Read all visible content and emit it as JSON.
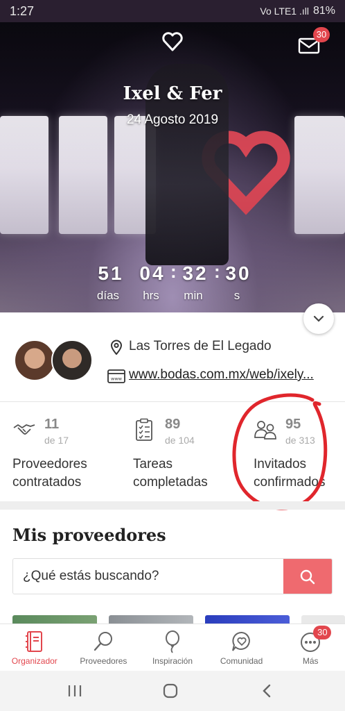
{
  "status_bar": {
    "time": "1:27",
    "signal": "Vo LTE1 .ıll",
    "battery": "81%"
  },
  "hero": {
    "couple_name": "Ixel & Fer",
    "date": "24 Agosto 2019",
    "mail_badge": "30",
    "countdown": {
      "days": "51",
      "hours": "04",
      "minutes": "32",
      "seconds": "30",
      "days_label": "días",
      "hours_label": "hrs",
      "minutes_label": "min",
      "seconds_label": "s"
    }
  },
  "info": {
    "venue": "Las Torres de El Legado",
    "website": "www.bodas.com.mx/web/ixely..."
  },
  "stats": [
    {
      "value": "11",
      "total": "de 17",
      "label_line1": "Proveedores",
      "label_line2": "contratados",
      "icon": "handshake-icon"
    },
    {
      "value": "89",
      "total": "de 104",
      "label_line1": "Tareas",
      "label_line2": "completadas",
      "icon": "checklist-icon"
    },
    {
      "value": "95",
      "total": "de 313",
      "label_line1": "Invitados",
      "label_line2": "confirmados",
      "icon": "guests-icon"
    }
  ],
  "providers": {
    "title": "Mis proveedores",
    "search_placeholder": "¿Qué estás buscando?"
  },
  "bottom_nav": {
    "items": [
      {
        "label": "Organizador",
        "icon": "notebook-icon",
        "active": true
      },
      {
        "label": "Proveedores",
        "icon": "search-icon",
        "active": false
      },
      {
        "label": "Inspiración",
        "icon": "balloon-icon",
        "active": false
      },
      {
        "label": "Comunidad",
        "icon": "chat-heart-icon",
        "active": false
      },
      {
        "label": "Más",
        "icon": "more-icon",
        "active": false,
        "badge": "30"
      }
    ]
  },
  "colors": {
    "accent": "#e2464d",
    "search_button": "#ef6a6f",
    "annotation_circle": "#e0262c"
  }
}
